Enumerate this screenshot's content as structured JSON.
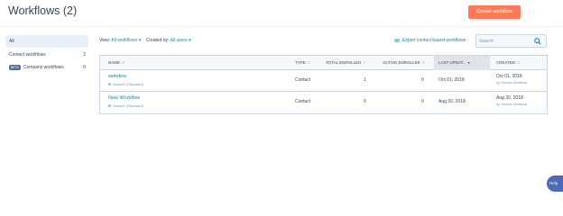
{
  "header": {
    "title": "Workflows (2)",
    "create_button": "Create workflow"
  },
  "sidebar": {
    "items": [
      {
        "label": "All",
        "count": "",
        "badge": ""
      },
      {
        "label": "Contact workflows",
        "count": "2",
        "badge": ""
      },
      {
        "label": "Company workflows",
        "count": "0",
        "badge": "BETA"
      }
    ]
  },
  "filters": {
    "view_label": "View:",
    "view_value": "All workflows",
    "created_label": "Created by:",
    "created_value": "All users"
  },
  "export_link": "Export contact based workflows",
  "search": {
    "placeholder": "Search",
    "value": ""
  },
  "table": {
    "columns": [
      "NAME",
      "TYPE",
      "TOTAL ENROLLED",
      "ACTIVE ENROLLED",
      "LAST UPDAT...",
      "CREATED"
    ],
    "rows": [
      {
        "name": "webdew",
        "status": "Inactive (Standard)",
        "type": "Contact",
        "total_enrolled": "1",
        "active_enrolled": "0",
        "last_updated": "Oct 01, 2018",
        "created_date": "Oct 01, 2018",
        "created_by": "by Danish Wadhwa"
      },
      {
        "name": "New Workflow",
        "status": "Inactive (Standard)",
        "type": "Contact",
        "total_enrolled": "0",
        "active_enrolled": "0",
        "last_updated": "Aug 30, 2018",
        "created_date": "Aug 30, 2018",
        "created_by": "by Danish Wadhwa"
      }
    ]
  },
  "help_button": "Help",
  "colors": {
    "accent": "#ff7a59",
    "link": "#0091ae",
    "text": "#33475b",
    "border": "#cbd6e2"
  }
}
